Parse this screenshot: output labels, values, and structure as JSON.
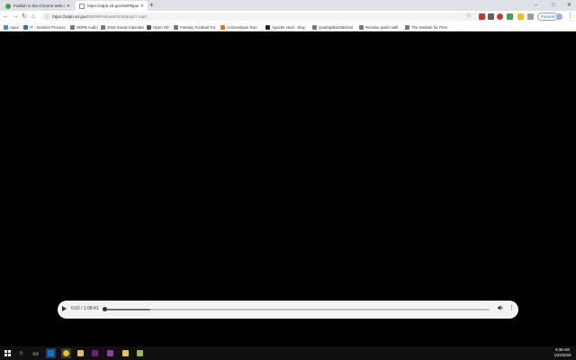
{
  "tabs": [
    {
      "title": "Publish in the Chrome Web Sto",
      "favicon_color": "#34a853",
      "active": false
    },
    {
      "title": "https://sdpb.sd.gov/SDPBpodcast/",
      "favicon_color": "#5f6368",
      "active": true
    }
  ],
  "newtab_icon": "+",
  "window_controls": {
    "minimize": "–",
    "maximize": "□",
    "close": "✕"
  },
  "toolbar": {
    "back": "←",
    "forward": "→",
    "reload": "↻",
    "home": "⌂",
    "lock_icon": "ⓘ",
    "url_host": "https://sdpb.sd.gov/",
    "url_path": "SDPBPodcast/2018/pop27.mp3",
    "star": "☆",
    "paused_label": "Paused",
    "menu": "⋮"
  },
  "bookmarks": [
    {
      "label": "Apps",
      "color": "#4285f4"
    },
    {
      "label": "IT - Session Process",
      "color": "#1a73e8"
    },
    {
      "label": "SDPB Audio",
      "color": "#777777"
    },
    {
      "label": "2018 Social Calendar",
      "color": "#777777"
    },
    {
      "label": "Open SD",
      "color": "#555555"
    },
    {
      "label": "Fantasy Football Tra",
      "color": "#777777"
    },
    {
      "label": "Ai Developer Run",
      "color": "#e8710a"
    },
    {
      "label": "Apache Hudi - Stay",
      "color": "#222222"
    },
    {
      "label": "/pod/spdb42266/Sol",
      "color": "#777777"
    },
    {
      "label": "Resolve push notifi",
      "color": "#777777"
    },
    {
      "label": "The Institute for Pres",
      "color": "#777777"
    }
  ],
  "player": {
    "play_icon": "▶",
    "time_label": "0:02 / 1:08:41",
    "buffered_fraction": 0.12,
    "played_fraction": 0.0005,
    "volume_icon": "🔊",
    "more_icon": "⋮"
  },
  "taskbar": {
    "items": [
      {
        "name": "start-button",
        "glyph": "⊞",
        "color": "#ffffff"
      },
      {
        "name": "search-icon",
        "glyph": "○",
        "color": "#ffffff"
      },
      {
        "name": "task-view-icon",
        "glyph": "▭",
        "color": "#ffffff"
      },
      {
        "name": "outlook-icon",
        "glyph": "",
        "color": "#0078d4"
      },
      {
        "name": "chrome-icon",
        "glyph": "",
        "color": "#fbbc05"
      },
      {
        "name": "app-icon-1",
        "glyph": "",
        "color": "#e0c060"
      },
      {
        "name": "visual-studio-icon",
        "glyph": "",
        "color": "#68217a"
      },
      {
        "name": "file-explorer-icon",
        "glyph": "",
        "color": "#f0c040"
      },
      {
        "name": "notepad-icon",
        "glyph": "",
        "color": "#9cb946"
      }
    ],
    "clock_time": "9:38 AM",
    "clock_date": "1/22/2019"
  }
}
